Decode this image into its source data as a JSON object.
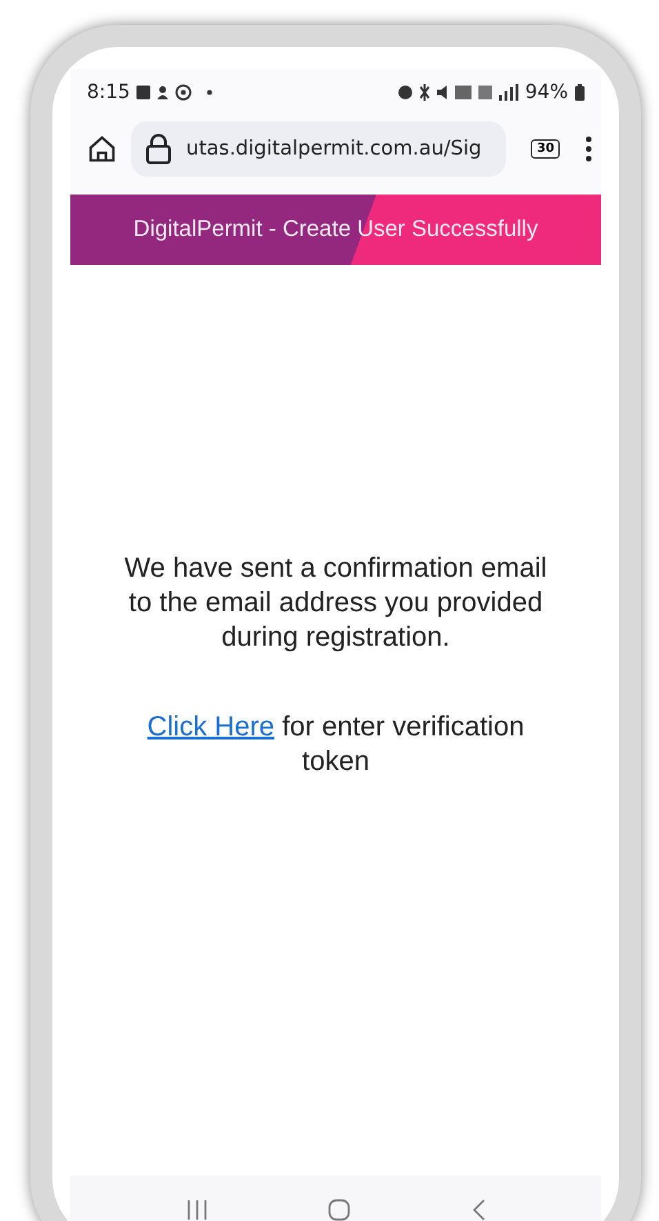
{
  "status_bar": {
    "time": "8:15",
    "battery": "94%"
  },
  "browser": {
    "url": "utas.digitalpermit.com.au/Sig",
    "tab_count": "30"
  },
  "header": {
    "title": "DigitalPermit - Create User Successfully"
  },
  "message": "We have sent a confirmation email to the email address you provided during registration.",
  "verification": {
    "link": "Click Here",
    "text": "for enter verification token"
  }
}
